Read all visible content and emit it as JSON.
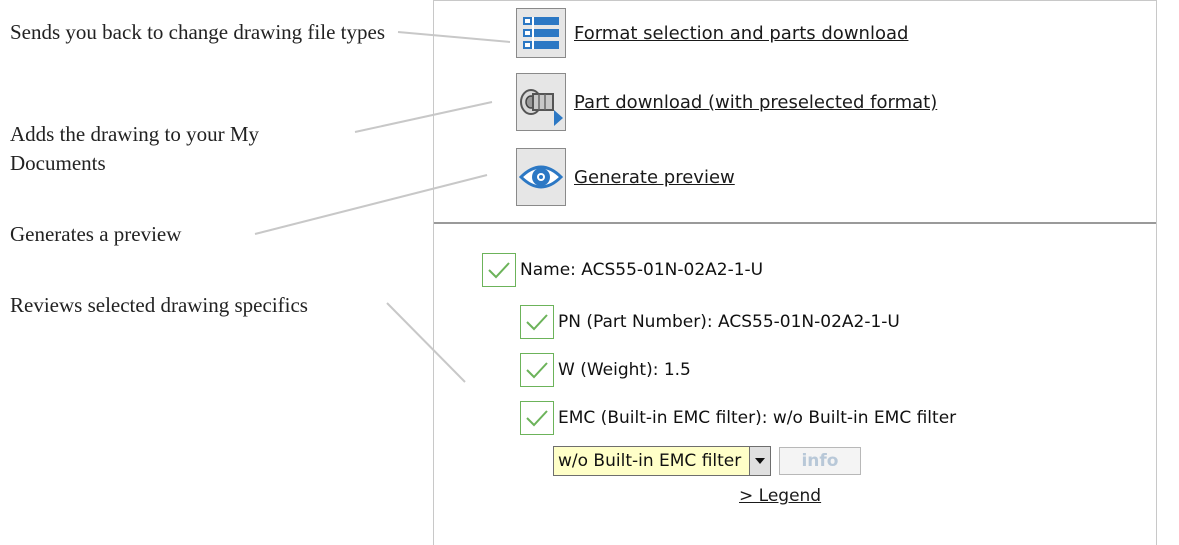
{
  "annotations": {
    "format_selection": "Sends you back to change drawing file types",
    "part_download": "Adds the drawing to your My Documents",
    "preview": "Generates a preview",
    "specifics": "Reviews selected drawing specifics"
  },
  "actions": {
    "format_selection": "Format selection and parts download",
    "part_download": "Part download (with preselected format)",
    "generate_preview": "Generate preview"
  },
  "specs": {
    "name": "Name: ACS55-01N-02A2-1-U",
    "part_number": "PN (Part Number): ACS55-01N-02A2-1-U",
    "weight": "W (Weight): 1.5",
    "emc": "EMC (Built-in EMC filter): w/o Built-in EMC filter"
  },
  "emc_select": {
    "value": "w/o Built-in EMC filter"
  },
  "info_button": "info",
  "legend_link": "> Legend",
  "colors": {
    "check": "#6cb35a",
    "select_bg": "#ffffc8",
    "icon_blue": "#2c78c4"
  }
}
